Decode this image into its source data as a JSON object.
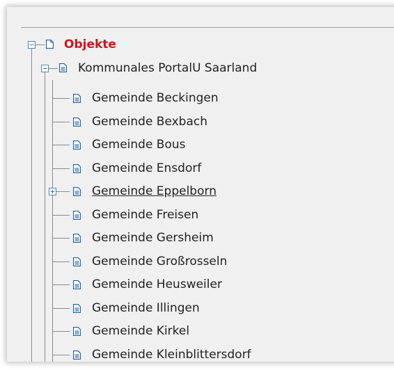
{
  "tree": {
    "root": {
      "label": "Objekte",
      "icon": "page-icon",
      "toggle": "−"
    },
    "group": {
      "label": "Kommunales PortalU Saarland",
      "icon": "document-icon",
      "toggle": "−"
    },
    "items": [
      {
        "label": "Gemeinde Beckingen",
        "icon": "document-icon"
      },
      {
        "label": "Gemeinde Bexbach",
        "icon": "document-icon"
      },
      {
        "label": "Gemeinde Bous",
        "icon": "document-icon"
      },
      {
        "label": "Gemeinde Ensdorf",
        "icon": "document-icon"
      },
      {
        "label": "Gemeinde Eppelborn",
        "icon": "document-icon",
        "toggle": "+"
      },
      {
        "label": "Gemeinde Freisen",
        "icon": "document-icon"
      },
      {
        "label": "Gemeinde Gersheim",
        "icon": "document-icon"
      },
      {
        "label": "Gemeinde Großrosseln",
        "icon": "document-icon"
      },
      {
        "label": "Gemeinde Heusweiler",
        "icon": "document-icon"
      },
      {
        "label": "Gemeinde Illingen",
        "icon": "document-icon"
      },
      {
        "label": "Gemeinde Kirkel",
        "icon": "document-icon"
      },
      {
        "label": "Gemeinde Kleinblittersdorf",
        "icon": "document-icon"
      }
    ]
  },
  "colors": {
    "root_label": "#c8171e",
    "icon_blue": "#1f5f9a",
    "panel_bg": "#f0f0f0"
  }
}
